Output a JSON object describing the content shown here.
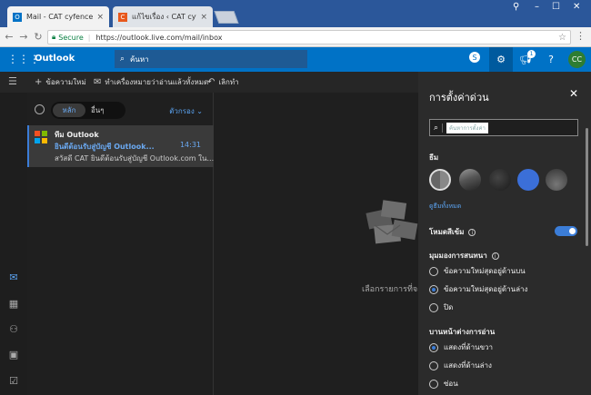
{
  "browser": {
    "tabs": [
      {
        "label": "Mail - CAT cyfence - Outl",
        "icon_color": "#0072c6",
        "icon_text": "O"
      },
      {
        "label": "แก้ไขเรื่อง ‹ CAT cyfence ฐ",
        "icon_color": "#e8581c",
        "icon_text": "C"
      }
    ],
    "secure_label": "Secure",
    "url": "https://outlook.live.com/mail/inbox"
  },
  "header": {
    "brand": "Outlook",
    "search_placeholder": "ค้นหา",
    "notification_count": "1",
    "avatar_initials": "CC"
  },
  "commands": {
    "new_message": "ข้อความใหม่",
    "mark_all_read": "ทำเครื่องหมายว่าอ่านแล้วทั้งหมด",
    "undo": "เลิกทำ"
  },
  "list": {
    "focused": "หลัก",
    "other": "อื่นๆ",
    "filter": "ตัวกรอง ⌄",
    "messages": [
      {
        "sender": "ทีม Outlook",
        "subject": "ยินดีต้อนรับสู่บัญชี Outlook...",
        "time": "14:31",
        "preview": "สวัสดี CAT ยินดีต้อนรับสู่บัญชี Outlook.com ใน..."
      }
    ]
  },
  "reading": {
    "hint": "เลือกรายการที่จะอ่าน"
  },
  "settings": {
    "title": "การตั้งค่าด่วน",
    "search_placeholder": "ค้นหาการตั้งค่า",
    "theme_label": "ธีม",
    "themes": [
      "gray",
      "mountain",
      "leaves",
      "blue",
      "palm"
    ],
    "all_themes": "ดูธีมทั้งหมด",
    "dark_mode_label": "โหมดสีเข้ม",
    "conversation_label": "มุมมองการสนทนา",
    "conversation_options": [
      {
        "label": "ข้อความใหม่สุดอยู่ด้านบน",
        "selected": false
      },
      {
        "label": "ข้อความใหม่สุดอยู่ด้านล่าง",
        "selected": true
      },
      {
        "label": "ปิด",
        "selected": false
      }
    ],
    "reading_pane_label": "บานหน้าต่างการอ่าน",
    "reading_pane_options": [
      {
        "label": "แสดงที่ด้านขวา",
        "selected": true
      },
      {
        "label": "แสดงที่ด้านล่าง",
        "selected": false
      },
      {
        "label": "ซ่อน",
        "selected": false
      }
    ]
  }
}
